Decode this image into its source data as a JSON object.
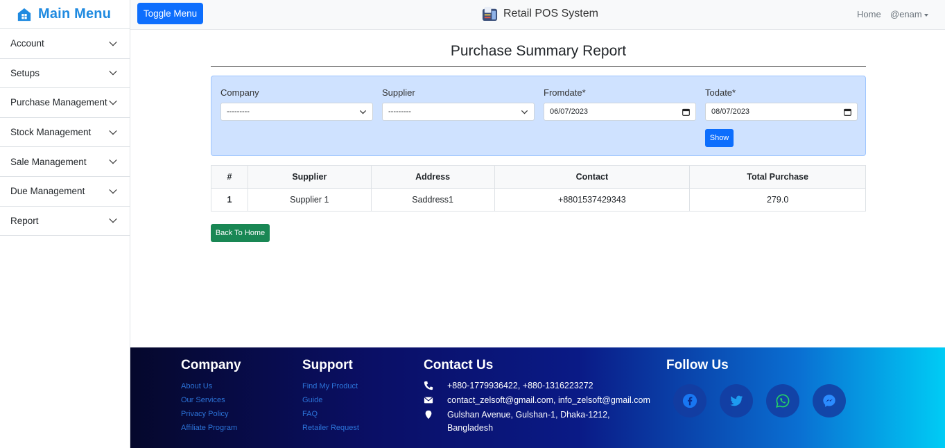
{
  "sidebar": {
    "title": "Main Menu",
    "items": [
      {
        "label": "Account"
      },
      {
        "label": "Setups"
      },
      {
        "label": "Purchase Management"
      },
      {
        "label": "Stock Management"
      },
      {
        "label": "Sale Management"
      },
      {
        "label": "Due Management"
      },
      {
        "label": "Report"
      }
    ]
  },
  "topbar": {
    "toggle_label": "Toggle Menu",
    "brand": "Retail POS System",
    "home_link": "Home",
    "user": "@enam"
  },
  "report": {
    "title": "Purchase Summary Report",
    "filters": {
      "company_label": "Company",
      "company_value": "---------",
      "supplier_label": "Supplier",
      "supplier_value": "---------",
      "fromdate_label": "Fromdate*",
      "fromdate_value": "06/07/2023",
      "todate_label": "Todate*",
      "todate_value": "08/07/2023",
      "show_label": "Show"
    },
    "table": {
      "headers": [
        "#",
        "Supplier",
        "Address",
        "Contact",
        "Total Purchase"
      ],
      "rows": [
        [
          "1",
          "Supplier 1",
          "Saddress1",
          "+8801537429343",
          "279.0"
        ]
      ]
    },
    "back_label": "Back To Home"
  },
  "footer": {
    "company": {
      "heading": "Company",
      "links": [
        "About Us",
        "Our Services",
        "Privacy Policy",
        "Affiliate Program"
      ]
    },
    "support": {
      "heading": "Support",
      "links": [
        "Find My Product",
        "Guide",
        "FAQ",
        "Retailer Request"
      ]
    },
    "contact": {
      "heading": "Contact Us",
      "phone": "+880-1779936422, +880-1316223272",
      "email": "contact_zelsoft@gmail.com, info_zelsoft@gmail.com",
      "address": "Gulshan Avenue, Gulshan-1, Dhaka-1212, Bangladesh"
    },
    "follow": {
      "heading": "Follow Us",
      "icons": [
        "facebook-icon",
        "twitter-icon",
        "whatsapp-icon",
        "messenger-icon"
      ]
    }
  },
  "colors": {
    "primary": "#0d6efd",
    "success": "#198754",
    "brand_blue": "#1f8ae0",
    "filter_bg": "#cfe2ff"
  }
}
